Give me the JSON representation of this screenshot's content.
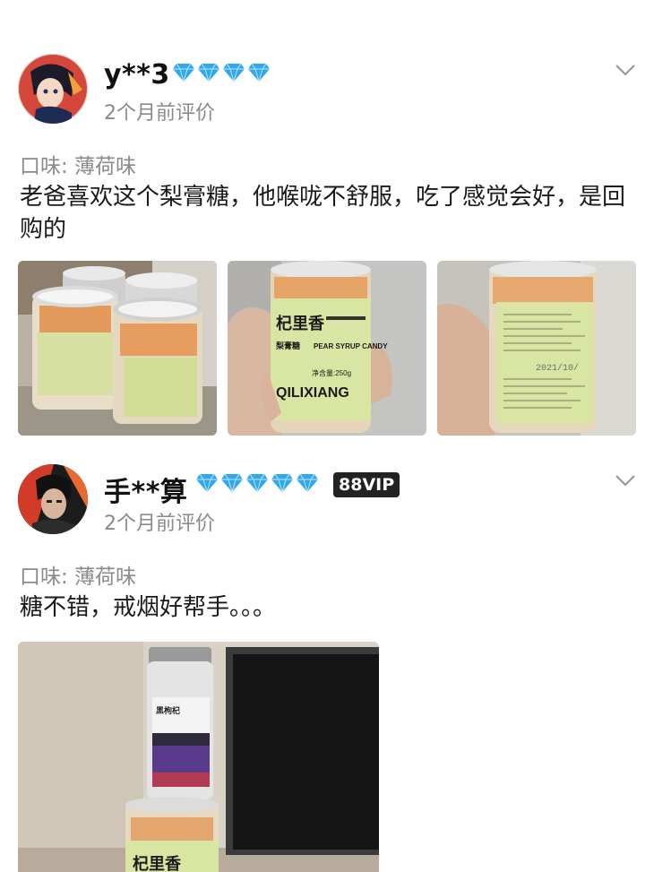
{
  "reviews": [
    {
      "username": "y**3",
      "diamond_count": 4,
      "time": "2个月前评价",
      "flavor": "口味: 薄荷味",
      "text": "老爸喜欢这个梨膏糖，他喉咙不舒服，吃了感觉会好，是回购的",
      "photos": [
        {
          "icon": "candy-jars-photo"
        },
        {
          "icon": "candy-jar-front-photo",
          "brand": "杞里香",
          "product": "梨膏糖",
          "english": "PEAR SYRUP CANDY",
          "net": "净含量:250g",
          "brand_en": "QILIXIANG"
        },
        {
          "icon": "candy-jar-back-photo",
          "date": "2021/10/"
        }
      ]
    },
    {
      "username": "手**算",
      "diamond_count": 5,
      "badge": "88VIP",
      "time": "2个月前评价",
      "flavor": "口味: 薄荷味",
      "text": "糖不错，戒烟好帮手。。。",
      "photos": [
        {
          "icon": "candy-jars-monitor-photo",
          "brand": "杞里香",
          "top_label": "黑枸杞"
        }
      ]
    }
  ],
  "colors": {
    "diamond": "#2fa8f0",
    "muted": "#8a8a8a",
    "label_green": "#d9e6a3"
  }
}
